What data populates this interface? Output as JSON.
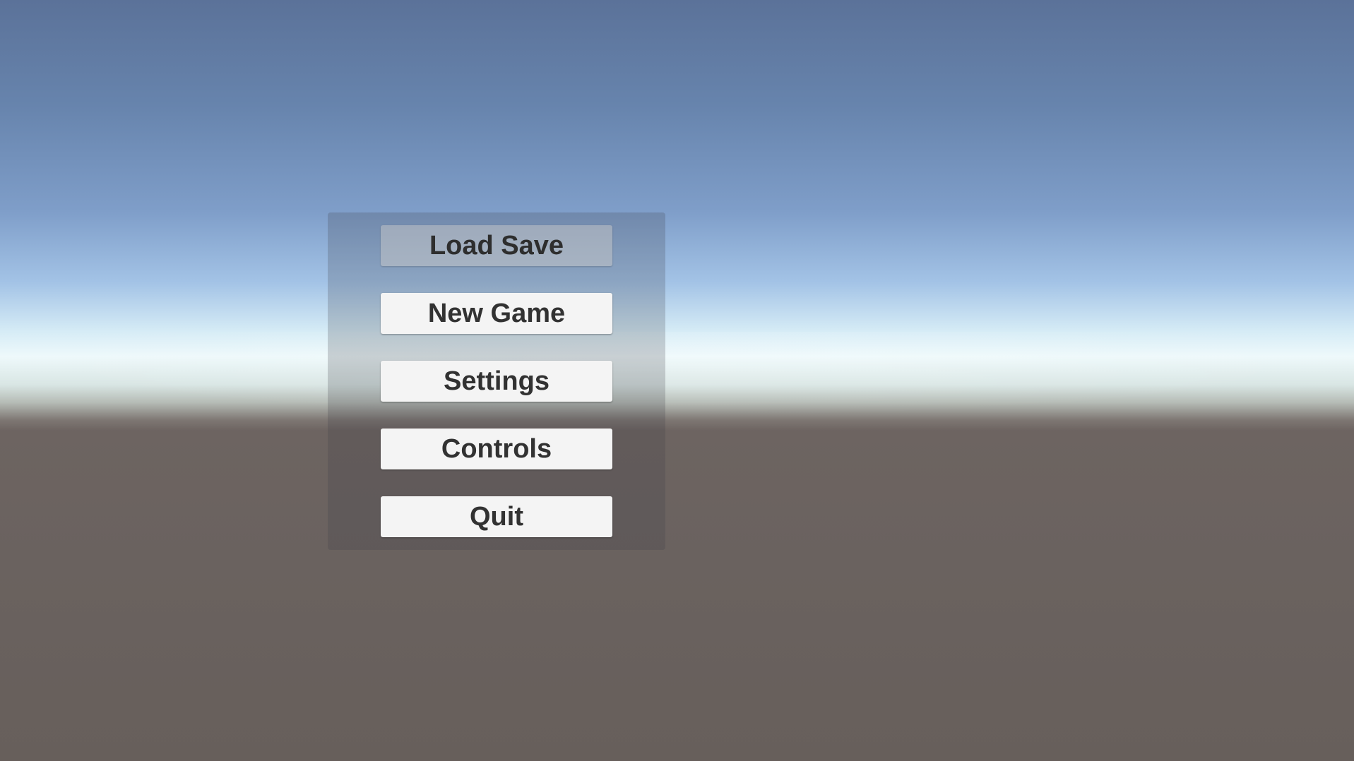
{
  "main_menu": {
    "buttons": [
      {
        "label": "Load Save",
        "state": "disabled"
      },
      {
        "label": "New Game",
        "state": "normal"
      },
      {
        "label": "Settings",
        "state": "normal"
      },
      {
        "label": "Controls",
        "state": "normal"
      },
      {
        "label": "Quit",
        "state": "normal"
      }
    ]
  },
  "colors": {
    "sky_top": "#5b7299",
    "horizon": "#eef9fb",
    "ground": "#6a625f",
    "button_bg": "#f4f4f4",
    "button_text": "#323232"
  }
}
